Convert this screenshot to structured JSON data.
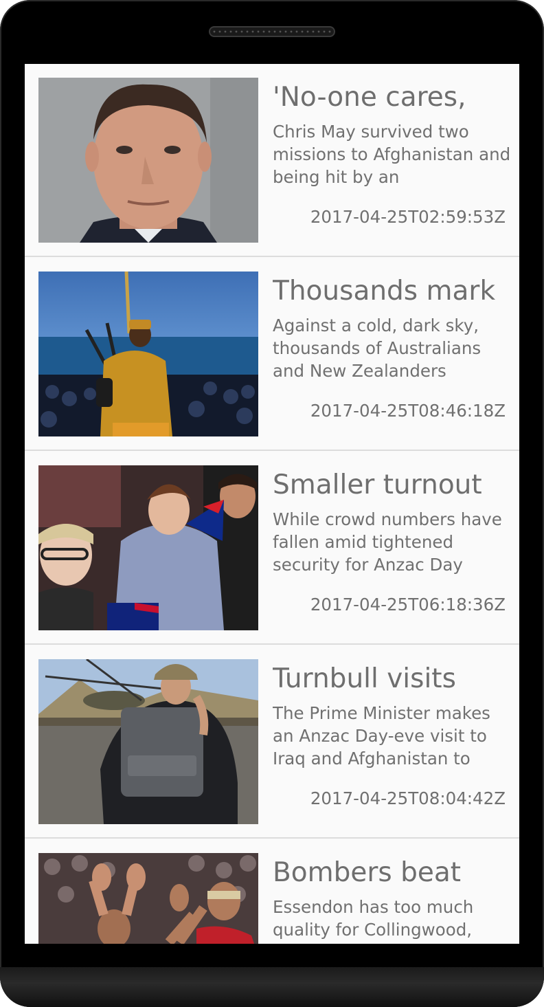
{
  "articles": [
    {
      "title": "'No-one cares,",
      "description": "Chris May survived two missions to Afghanistan and being hit by an",
      "date": "2017-04-25T02:59:53Z",
      "image": "portrait-man-photo"
    },
    {
      "title": "Thousands mark",
      "description": "Against a cold, dark sky, thousands of Australians and New Zealanders",
      "date": "2017-04-25T08:46:18Z",
      "image": "bagpiper-dawn-service-photo"
    },
    {
      "title": "Smaller turnout",
      "description": "While crowd numbers have fallen amid tightened security for Anzac Day",
      "date": "2017-04-25T06:18:36Z",
      "image": "crowd-family-flag-photo"
    },
    {
      "title": "Turnbull visits",
      "description": "The Prime Minister makes an Anzac Day-eve visit to Iraq and Afghanistan to",
      "date": "2017-04-25T08:04:42Z",
      "image": "prime-minister-helicopter-photo"
    },
    {
      "title": "Bombers beat",
      "description": "Essendon has too much quality for Collingwood,",
      "date": "",
      "image": "football-players-celebrate-photo"
    }
  ]
}
